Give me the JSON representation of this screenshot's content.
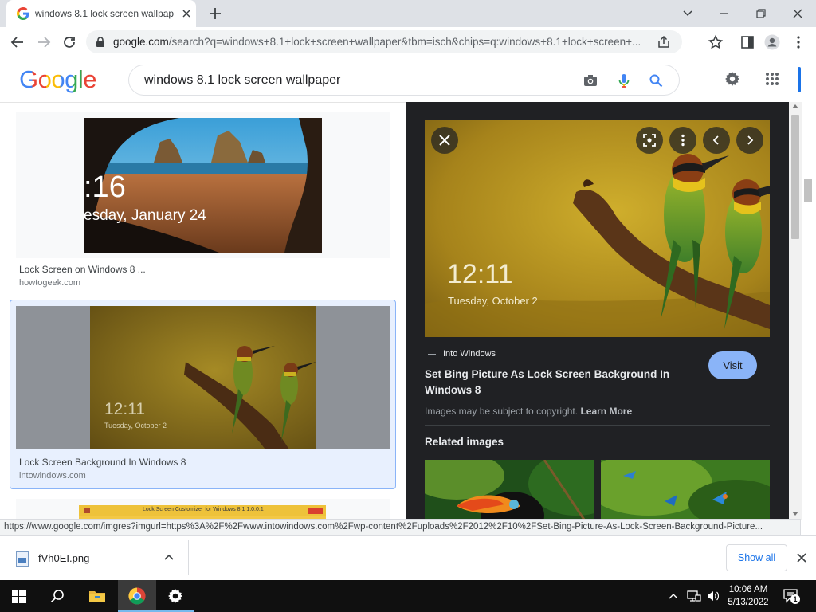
{
  "browser": {
    "tab_title": "windows 8.1 lock screen wallpap",
    "url_host": "google.com",
    "url_rest": "/search?q=windows+8.1+lock+screen+wallpaper&tbm=isch&chips=q:windows+8.1+lock+screen+..."
  },
  "google": {
    "logo": "Google",
    "query": "windows 8.1 lock screen wallpaper"
  },
  "results": [
    {
      "title": "Lock Screen on Windows 8 ...",
      "source": "howtogeek.com",
      "thumb_time": ":16",
      "thumb_date": "esday, January 24"
    },
    {
      "title": "Lock Screen Background In Windows 8",
      "source": "intowindows.com",
      "thumb_time": "12:11",
      "thumb_date": "Tuesday, October 2"
    },
    {
      "thumb_caption": "Lock Screen Customizer for Windows 8.1 1.0.0.1"
    }
  ],
  "preview": {
    "time": "12:11",
    "date": "Tuesday, October 2",
    "site": "Into Windows",
    "title": "Set Bing Picture As Lock Screen Background In Windows 8",
    "visit_label": "Visit",
    "copyright": "Images may be subject to copyright.",
    "learn_more": "Learn More",
    "related_heading": "Related images"
  },
  "status_url": "https://www.google.com/imgres?imgurl=https%3A%2F%2Fwww.intowindows.com%2Fwp-content%2Fuploads%2F2012%2F10%2FSet-Bing-Picture-As-Lock-Screen-Background-Picture...",
  "downloads": {
    "file": "fVh0EI.png",
    "show_all": "Show all"
  },
  "taskbar": {
    "time": "10:06 AM",
    "date": "5/13/2022",
    "notifications": "1"
  },
  "colors": {
    "accent": "#1a73e8",
    "visit_button": "#8ab4f8",
    "panel_bg": "#202124"
  }
}
